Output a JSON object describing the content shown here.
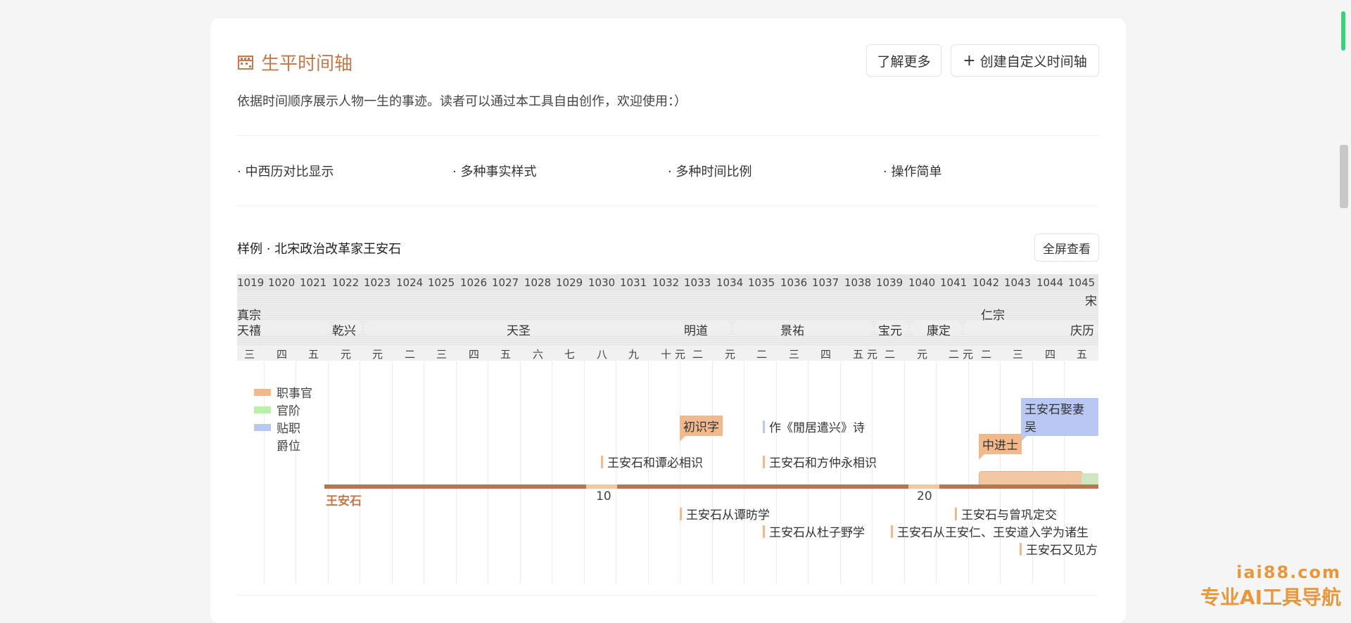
{
  "header": {
    "title": "生平时间轴",
    "learn_more": "了解更多",
    "create_plus": "+",
    "create_label": "创建自定义时间轴",
    "description": "依据时间顺序展示人物一生的事迹。读者可以通过本工具自由创作，欢迎使用：）"
  },
  "features": [
    "· 中西历对比显示",
    "· 多种事实样式",
    "· 多种时间比例",
    "· 操作简单"
  ],
  "sample": {
    "title": "样例 · 北宋政治改革家王安石",
    "fullscreen": "全屏查看"
  },
  "timeline": {
    "years": [
      "1019",
      "1020",
      "1021",
      "1022",
      "1023",
      "1024",
      "1025",
      "1026",
      "1027",
      "1028",
      "1029",
      "1030",
      "1031",
      "1032",
      "1033",
      "1034",
      "1035",
      "1036",
      "1037",
      "1038",
      "1039",
      "1040",
      "1041",
      "1042",
      "1043",
      "1044",
      "1045"
    ],
    "dynasty": "宋",
    "emperors": {
      "e1": "真宗",
      "e2": "仁宗"
    },
    "eras": {
      "r1": "天禧",
      "r2": "乾兴",
      "r3": "天圣",
      "r4": "明道",
      "r5": "景祐",
      "r6": "宝元",
      "r7": "康定",
      "r8": "庆历"
    },
    "ordinals": [
      "三",
      "四",
      "五",
      "元",
      "元",
      "二",
      "三",
      "四",
      "五",
      "六",
      "七",
      "八",
      "九",
      "十",
      "元",
      "二",
      "元",
      "二",
      "三",
      "四",
      "五",
      "元",
      "二",
      "元",
      "二",
      "元",
      "二",
      "三",
      "四",
      "五"
    ],
    "legend": {
      "l1": "职事官",
      "l2": "官阶",
      "l3": "贴职",
      "l4": "爵位"
    },
    "legend_colors": {
      "l1": "#f2b98c",
      "l2": "#b8f2a8",
      "l3": "#b9c8f2"
    },
    "person": "王安石",
    "ages": {
      "a1": "10",
      "a2": "20"
    },
    "events_above": {
      "ev1": "初识字",
      "ev2": "作《閒居遣兴》诗",
      "ev3": "王安石娶妻吴",
      "ev4": "中进士",
      "ev5": "王安石和谭必相识",
      "ev6": "王安石和方仲永相识"
    },
    "events_below": {
      "ev7": "王安石从谭昉学",
      "ev8": "王安石与曾巩定交",
      "ev9": "王安石从杜子野学",
      "ev10": "王安石从王安仁、王安道入学为诸生",
      "ev11": "王安石又见方"
    }
  },
  "watermark": {
    "domain": "iai88.com",
    "slogan": "专业AI工具导航"
  },
  "colors": {
    "accent": "#c47a4a",
    "lifeline": "#b87551"
  }
}
